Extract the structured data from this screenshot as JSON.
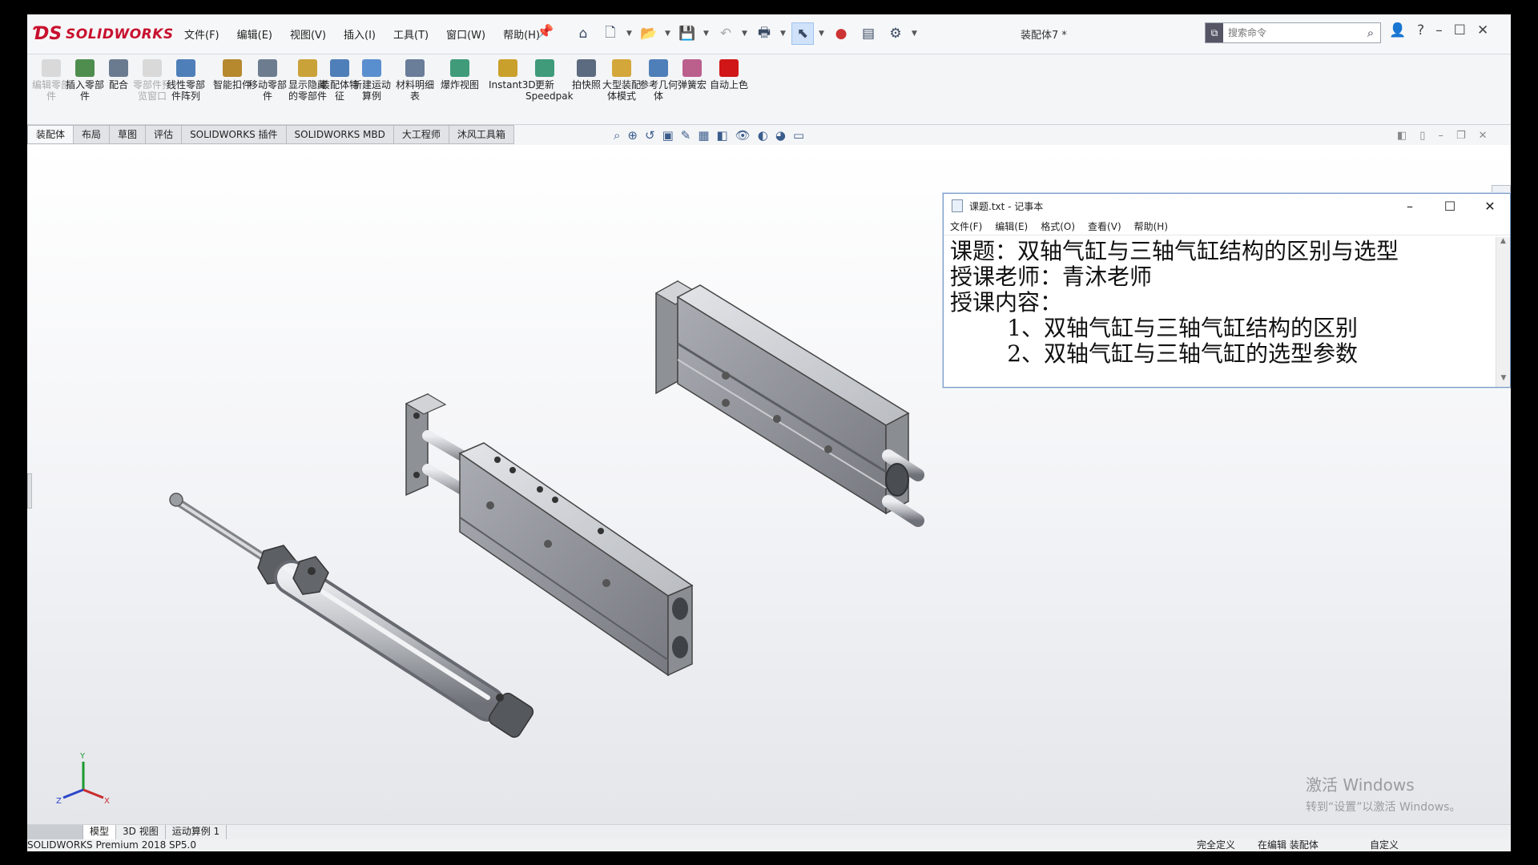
{
  "app": {
    "brand": "SOLIDWORKS",
    "menu": [
      "文件(F)",
      "编辑(E)",
      "视图(V)",
      "插入(I)",
      "工具(T)",
      "窗口(W)",
      "帮助(H)"
    ],
    "document_title": "装配体7 *",
    "search_placeholder": "搜索命令"
  },
  "ribbon": [
    {
      "label": "编辑零部件",
      "icon": "edit-component-icon",
      "disabled": true
    },
    {
      "label": "插入零部件",
      "icon": "insert-component-icon",
      "disabled": false
    },
    {
      "label": "配合",
      "icon": "mate-icon",
      "disabled": false
    },
    {
      "label": "零部件预览窗口",
      "icon": "component-preview-icon",
      "disabled": true
    },
    {
      "label": "线性零部件阵列",
      "icon": "linear-pattern-icon",
      "disabled": false
    },
    {
      "label": "智能扣件",
      "icon": "smart-fasteners-icon",
      "disabled": false
    },
    {
      "label": "移动零部件",
      "icon": "move-component-icon",
      "disabled": false
    },
    {
      "label": "显示隐藏的零部件",
      "icon": "show-hidden-icon",
      "disabled": false
    },
    {
      "label": "装配体特征",
      "icon": "assembly-features-icon",
      "disabled": false
    },
    {
      "label": "新建运动算例",
      "icon": "motion-study-icon",
      "disabled": false
    },
    {
      "label": "材料明细表",
      "icon": "bom-icon",
      "disabled": false
    },
    {
      "label": "爆炸视图",
      "icon": "exploded-view-icon",
      "disabled": false
    },
    {
      "label": "Instant3D",
      "icon": "instant3d-icon",
      "disabled": false
    },
    {
      "label": "更新Speedpak",
      "icon": "speedpak-icon",
      "disabled": false
    },
    {
      "label": "拍快照",
      "icon": "snapshot-icon",
      "disabled": false
    },
    {
      "label": "大型装配体模式",
      "icon": "large-assembly-icon",
      "disabled": false
    },
    {
      "label": "参考几何体",
      "icon": "reference-geometry-icon",
      "disabled": false
    },
    {
      "label": "弹簧宏",
      "icon": "spring-macro-icon",
      "disabled": false
    },
    {
      "label": "自动上色",
      "icon": "auto-color-icon",
      "disabled": false
    }
  ],
  "tabs": [
    "装配体",
    "布局",
    "草图",
    "评估",
    "SOLIDWORKS 插件",
    "SOLIDWORKS MBD",
    "大工程师",
    "沐风工具箱"
  ],
  "notepad": {
    "title": "课题.txt - 记事本",
    "menu": [
      "文件(F)",
      "编辑(E)",
      "格式(O)",
      "查看(V)",
      "帮助(H)"
    ],
    "lines": [
      "课题：双轴气缸与三轴气缸结构的区别与选型",
      "授课老师：青沐老师",
      "授课内容：",
      "        1、双轴气缸与三轴气缸结构的区别",
      "        2、双轴气缸与三轴气缸的选型参数"
    ]
  },
  "watermark": {
    "title": "激活 Windows",
    "subtitle": "转到“设置”以激活 Windows。"
  },
  "bottom_tabs": [
    "模型",
    "3D 视图",
    "运动算例 1"
  ],
  "status": {
    "version": "SOLIDWORKS Premium 2018 SP5.0",
    "definition": "完全定义",
    "editing": "在编辑 装配体",
    "units": "自定义"
  },
  "colors": {
    "brand_red": "#c8102e",
    "accent_blue": "#1e6fd9"
  }
}
